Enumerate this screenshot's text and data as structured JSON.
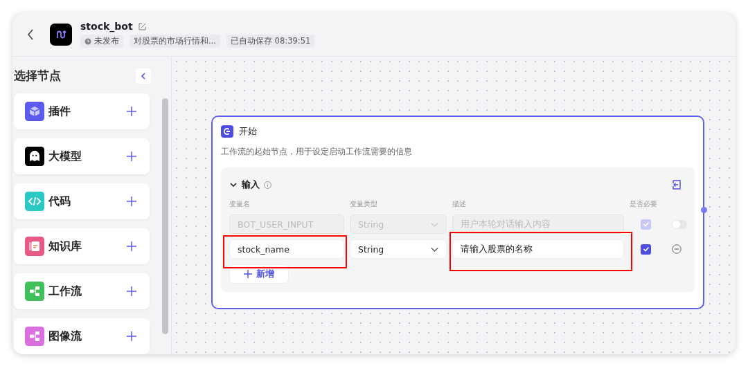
{
  "header": {
    "title": "stock_bot",
    "status": "未发布",
    "description": "对股票的市场行情和...",
    "saved": "已自动保存 08:39:51"
  },
  "sidebar": {
    "title": "选择节点",
    "items": [
      {
        "label": "插件",
        "kind": "plugin"
      },
      {
        "label": "大模型",
        "kind": "llm"
      },
      {
        "label": "代码",
        "kind": "code"
      },
      {
        "label": "知识库",
        "kind": "knowledge"
      },
      {
        "label": "工作流",
        "kind": "workflow"
      },
      {
        "label": "图像流",
        "kind": "imageflow"
      }
    ]
  },
  "node": {
    "title": "开始",
    "description": "工作流的起始节点，用于设定启动工作流需要的信息",
    "section": {
      "title": "输入",
      "expanded": true,
      "columns": [
        "变量名",
        "变量类型",
        "描述",
        "是否必要"
      ],
      "rows": [
        {
          "kind": "system",
          "disabled": true,
          "name": "BOT_USER_INPUT",
          "type": "String",
          "description": "用户本轮对话输入内容",
          "required": true,
          "on": false,
          "name_highlighted": false,
          "description_highlighted": false
        },
        {
          "kind": "custom",
          "disabled": false,
          "name": "stock_name",
          "type": "String",
          "description": "请输入股票的名称",
          "required": true,
          "name_highlighted": true,
          "description_highlighted": true
        }
      ],
      "add_label": "新增"
    }
  }
}
